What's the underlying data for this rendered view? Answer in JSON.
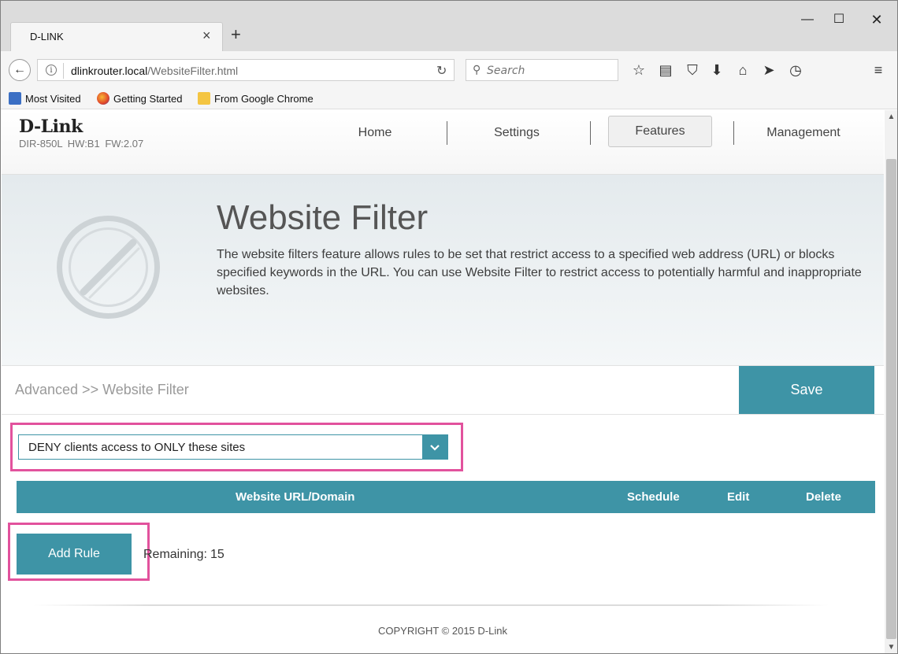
{
  "browser": {
    "tab_title": "D-LINK",
    "url_host": "dlinkrouter.local",
    "url_path": "/WebsiteFilter.html",
    "search_placeholder": "Search",
    "bookmarks": [
      "Most Visited",
      "Getting Started",
      "From Google Chrome"
    ],
    "toolbar_icons": [
      "star-icon",
      "reading-list-icon",
      "pocket-icon",
      "download-icon",
      "home-icon",
      "share-icon",
      "history-icon",
      "menu-icon"
    ]
  },
  "header": {
    "logo": "D-Link",
    "model": "DIR-850L  HW:B1  FW:2.07",
    "nav": [
      "Home",
      "Settings",
      "Features",
      "Management"
    ],
    "active_nav": "Features"
  },
  "hero": {
    "title": "Website Filter",
    "description": "The website filters feature allows rules to be set that restrict access to a specified web address (URL) or blocks specified keywords in the URL. You can use Website Filter to restrict access to potentially harmful and inappropriate websites."
  },
  "breadcrumb": "Advanced >> Website Filter",
  "save_label": "Save",
  "filter_mode": "DENY clients access to ONLY these sites",
  "table": {
    "columns": [
      "Website URL/Domain",
      "Schedule",
      "Edit",
      "Delete"
    ]
  },
  "add_rule_label": "Add Rule",
  "remaining_label": "Remaining:",
  "remaining_count": "15",
  "copyright": "COPYRIGHT © 2015 D-Link",
  "colors": {
    "accent": "#3e94a6",
    "highlight": "#e2529d"
  }
}
